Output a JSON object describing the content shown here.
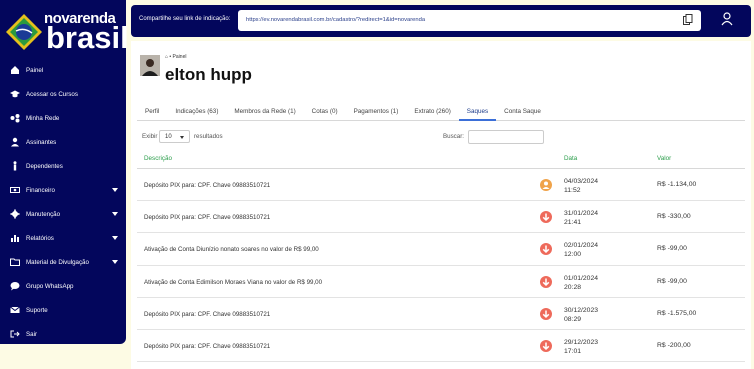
{
  "brand": {
    "top": "novarenda",
    "bottom": "brasil"
  },
  "sidebar": {
    "items": [
      {
        "label": "Painel",
        "icon": "home-icon",
        "has_caret": false
      },
      {
        "label": "Acessar os Cursos",
        "icon": "graduation-cap-icon",
        "has_caret": false
      },
      {
        "label": "Minha Rede",
        "icon": "network-icon",
        "has_caret": false
      },
      {
        "label": "Assinantes",
        "icon": "user-icon",
        "has_caret": false
      },
      {
        "label": "Dependentes",
        "icon": "person-icon",
        "has_caret": false
      },
      {
        "label": "Financeiro",
        "icon": "money-icon",
        "has_caret": true
      },
      {
        "label": "Manutenção",
        "icon": "gear-icon",
        "has_caret": true
      },
      {
        "label": "Relatórios",
        "icon": "bar-chart-icon",
        "has_caret": true
      },
      {
        "label": "Material de Divulgação",
        "icon": "folder-icon",
        "has_caret": true
      },
      {
        "label": "Grupo WhatsApp",
        "icon": "chat-icon",
        "has_caret": false
      },
      {
        "label": "Suporte",
        "icon": "mail-icon",
        "has_caret": false
      },
      {
        "label": "Sair",
        "icon": "logout-icon",
        "has_caret": false
      }
    ]
  },
  "topbar": {
    "share_label": "Compartilhe seu link de indicação:",
    "link": "https://ev.novarendabrasil.com.br/cadastro/?redirect=1&id=novarenda"
  },
  "header": {
    "breadcrumb": "• Painel",
    "title": "elton hupp"
  },
  "tabs": [
    {
      "label": "Perfil",
      "active": false
    },
    {
      "label": "Indicações (63)",
      "active": false
    },
    {
      "label": "Membros da Rede (1)",
      "active": false
    },
    {
      "label": "Cotas (0)",
      "active": false
    },
    {
      "label": "Pagamentos (1)",
      "active": false
    },
    {
      "label": "Extrato (260)",
      "active": false
    },
    {
      "label": "Saques",
      "active": true
    },
    {
      "label": "Conta Saque",
      "active": false
    }
  ],
  "controls": {
    "exibir": "Exibir",
    "page_size": "10",
    "resultados": "resultados",
    "buscar": "Buscar:"
  },
  "table": {
    "headers": {
      "description": "Descrição",
      "date": "Data",
      "value": "Valor"
    },
    "rows": [
      {
        "description": "Depósito PIX para: CPF. Chave 09883510721",
        "status": "pending",
        "date": "04/03/2024",
        "time": "11:52",
        "value": "R$ -1.134,00"
      },
      {
        "description": "Depósito PIX para: CPF. Chave 09883510721",
        "status": "down",
        "date": "31/01/2024",
        "time": "21:41",
        "value": "R$ -330,00"
      },
      {
        "description": "Ativação de Conta Diunízio nonato soares no valor de R$ 99,00",
        "status": "down",
        "date": "02/01/2024",
        "time": "12:00",
        "value": "R$ -99,00"
      },
      {
        "description": "Ativação de Conta Edimilson Moraes Viana no valor de R$ 99,00",
        "status": "down",
        "date": "01/01/2024",
        "time": "20:28",
        "value": "R$ -99,00"
      },
      {
        "description": "Depósito PIX para: CPF. Chave 09883510721",
        "status": "down",
        "date": "30/12/2023",
        "time": "08:29",
        "value": "R$ -1.575,00"
      },
      {
        "description": "Depósito PIX para: CPF. Chave 09883510721",
        "status": "down",
        "date": "29/12/2023",
        "time": "17:01",
        "value": "R$ -200,00"
      }
    ]
  },
  "colors": {
    "navy": "#03065c",
    "green": "#2a9d4a",
    "down": "#ee6a5b",
    "pending": "#f0a34a"
  }
}
